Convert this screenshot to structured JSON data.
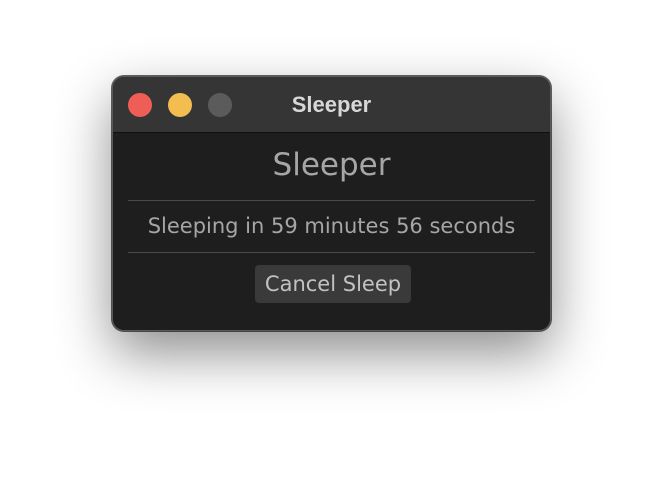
{
  "window": {
    "title": "Sleeper",
    "controls": [
      "close",
      "minimize",
      "zoom"
    ]
  },
  "main": {
    "heading": "Sleeper",
    "status": "Sleeping in 59 minutes 56 seconds",
    "cancel_label": "Cancel Sleep"
  },
  "colors": {
    "close": "#ee5e57",
    "minimize": "#f3bd4f",
    "zoom_disabled": "#5b5b5b",
    "background": "#1e1e1e",
    "titlebar": "#353535"
  }
}
